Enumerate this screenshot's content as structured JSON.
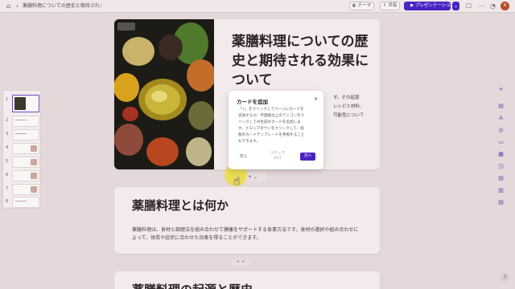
{
  "topbar": {
    "title": "薬膳料理についての歴史と期待される効果に...",
    "theme_label": "テーマ",
    "share_label": "共有",
    "present_label": "プレゼンテーション",
    "avatar_initials": "R"
  },
  "thumbnails": [
    "1",
    "2",
    "3",
    "4",
    "5",
    "6",
    "7",
    "8"
  ],
  "slide1": {
    "title": "薬膳料理についての歴史と期待される効果について",
    "body_lines": [
      "す。その起源",
      "レシピと材料、",
      "可能性について"
    ]
  },
  "slide2": {
    "title": "薬膳料理とは何か",
    "body_lines": [
      "薬膳料理は、食材と調理法を組み合わせて健康をサポートする食事方法です。食材の選択や組み合わせに",
      "よって、体質や症状に合わせた効果を得ることができます。"
    ]
  },
  "slide3": {
    "title": "薬膳料理の起源と歴史"
  },
  "popover": {
    "title": "カードを追加",
    "close": "×",
    "lines": [
      "「+」をクリックしてページにカードを",
      "追加するか、平面角仕上のアイコンをク",
      "リックしてAI生成のカードを追加しま",
      "す。ドロップダウンをクリックして、既",
      "製のカードテンプレートを参照すること",
      "もできます。"
    ],
    "skip_label": "閉る",
    "step_label": "ステップ",
    "step_count": "4/11",
    "next_label": "次へ"
  },
  "add_mini": "+ +",
  "right_tools": [
    "+",
    "▤",
    "A",
    "◎",
    "▭",
    "▦",
    "◳",
    "▤",
    "▥",
    "▤",
    "⊟",
    "▣"
  ],
  "help": "?",
  "colors": {
    "accent": "#4a24c2",
    "canvas": "#e4d8da",
    "card": "#f2eaeb"
  }
}
